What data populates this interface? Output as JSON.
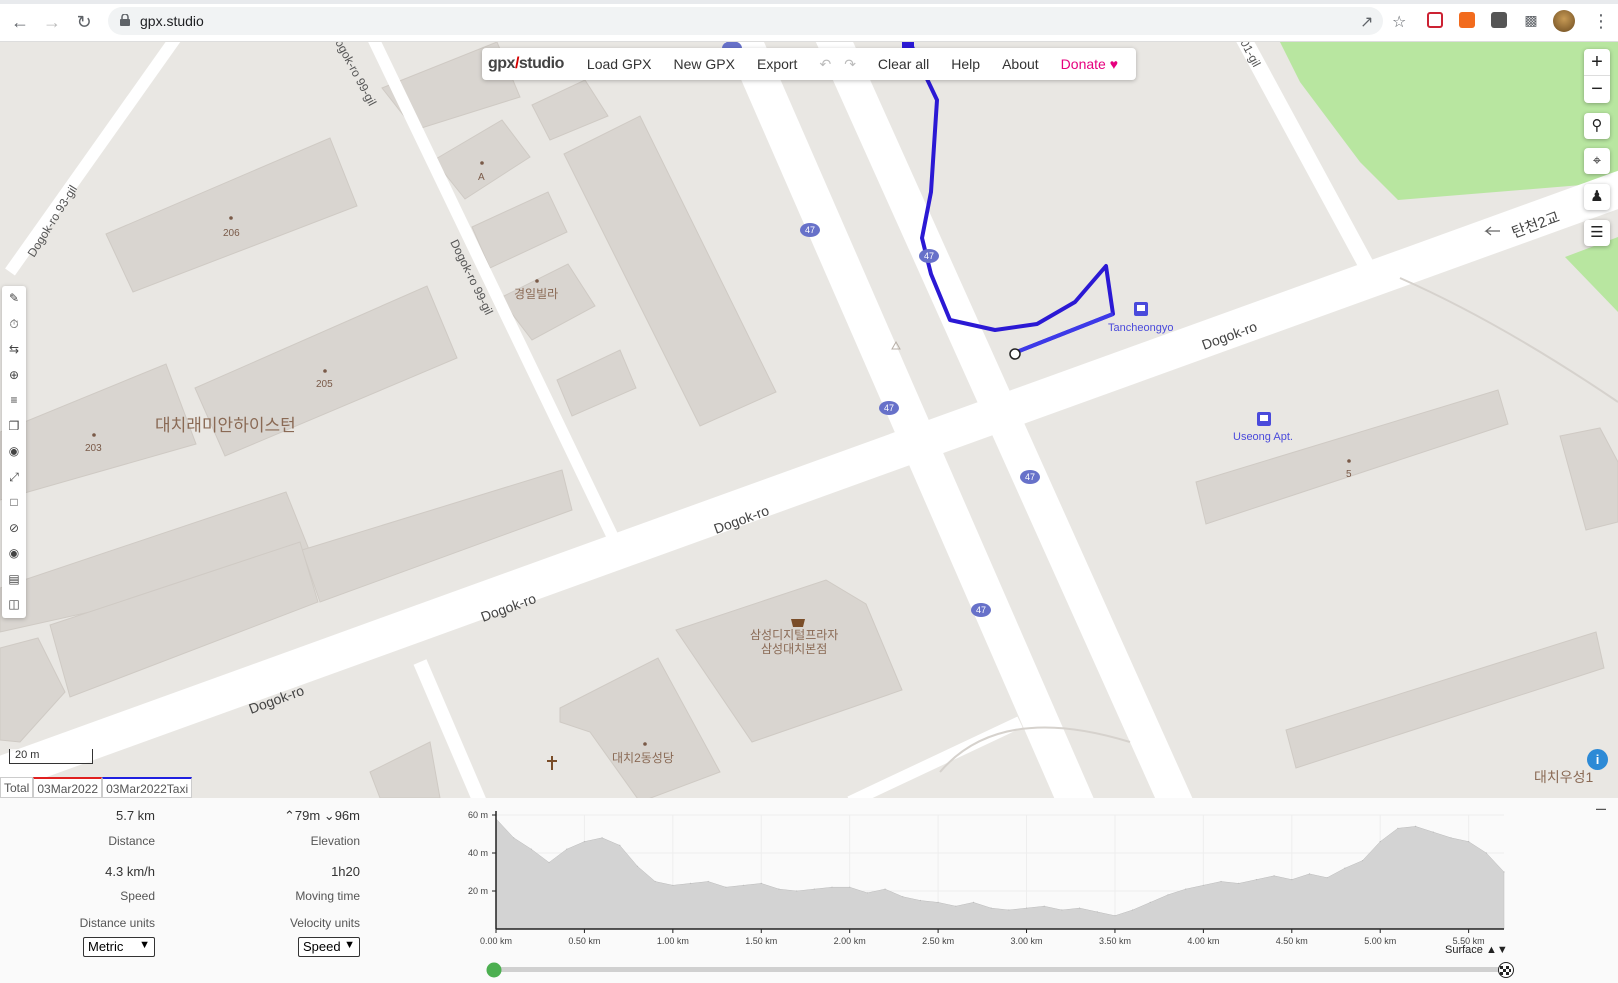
{
  "browser": {
    "url": "gpx.studio"
  },
  "toolbar": {
    "logo": "gpx.studio",
    "logo_a": "gpx",
    "logo_b": "studio",
    "load": "Load GPX",
    "new": "New GPX",
    "export": "Export",
    "clear": "Clear all",
    "help": "Help",
    "about": "About",
    "donate": "Donate"
  },
  "map": {
    "scale_label": "20 m",
    "labels": {
      "dogok_ro_93": "Dogok-ro 93-gil",
      "dogok_ro_99_top": "ogok-ro 99-gil",
      "dogok_ro_99": "Dogok-ro 99-gil",
      "gil_top": "01-gil",
      "dogok_ro_1": "Dogok-ro",
      "dogok_ro_2": "Dogok-ro",
      "dogok_ro_3": "Dogok-ro",
      "dogok_ro_4": "Dogok-ro",
      "tancheon_bridge": "탄천2교",
      "daechi_raemian": "대치래미안하이스턴",
      "gyeongil_villa": "경일빌라",
      "samsung_digital": "삼성디지털프라자",
      "samsung_daechi": "삼성대치본점",
      "daechi2_church": "대치2동성당",
      "daechi_bottom": "대치우성1",
      "building_206": "206",
      "building_205": "205",
      "building_203": "203",
      "building_a": "A",
      "building_5": "5",
      "stop_tancheongyo": "Tancheongyo",
      "stop_useong": "Useong Apt.",
      "route_47": "47"
    }
  },
  "track_tabs": [
    "Total",
    "03Mar2022",
    "03Mar2022Taxi"
  ],
  "stats": {
    "distance_value": "5.7 km",
    "distance_label": "Distance",
    "elevation_up": "79m",
    "elevation_down": "96m",
    "elevation_label": "Elevation",
    "speed_value": "4.3 km/h",
    "speed_label": "Speed",
    "moving_time_value": "1h20",
    "moving_time_label": "Moving time",
    "distance_units_label": "Distance units",
    "distance_units_value": "Metric",
    "velocity_units_label": "Velocity units",
    "velocity_units_value": "Speed"
  },
  "chart_data": {
    "type": "area",
    "title": "",
    "xlabel": "",
    "ylabel": "",
    "ylim": [
      0,
      60
    ],
    "xlim": [
      0,
      5.7
    ],
    "x_ticks": [
      "0.00 km",
      "0.50 km",
      "1.00 km",
      "1.50 km",
      "2.00 km",
      "2.50 km",
      "3.00 km",
      "3.50 km",
      "4.00 km",
      "4.50 km",
      "5.00 km",
      "5.50 km"
    ],
    "y_ticks": [
      "20 m",
      "40 m",
      "60 m"
    ],
    "x": [
      0.0,
      0.1,
      0.2,
      0.3,
      0.4,
      0.5,
      0.6,
      0.7,
      0.8,
      0.9,
      1.0,
      1.1,
      1.2,
      1.3,
      1.4,
      1.5,
      1.6,
      1.7,
      1.8,
      1.9,
      2.0,
      2.1,
      2.2,
      2.3,
      2.4,
      2.5,
      2.6,
      2.7,
      2.8,
      2.9,
      3.0,
      3.1,
      3.2,
      3.3,
      3.4,
      3.5,
      3.6,
      3.7,
      3.8,
      3.9,
      4.0,
      4.1,
      4.2,
      4.3,
      4.4,
      4.5,
      4.6,
      4.7,
      4.8,
      4.9,
      5.0,
      5.1,
      5.2,
      5.3,
      5.4,
      5.5,
      5.6,
      5.7
    ],
    "series": [
      {
        "values": [
          58,
          48,
          42,
          35,
          42,
          46,
          48,
          44,
          33,
          25,
          23,
          24,
          25,
          22,
          23,
          24,
          21,
          20,
          21,
          22,
          22,
          19,
          21,
          17,
          15,
          14,
          12,
          14,
          11,
          10,
          11,
          12,
          10,
          11,
          9,
          7,
          10,
          14,
          18,
          21,
          23,
          25,
          24,
          26,
          28,
          26,
          29,
          27,
          32,
          36,
          46,
          53,
          54,
          51,
          48,
          46,
          40,
          30
        ]
      }
    ],
    "grid": true,
    "legend": "",
    "footer_label": "Surface"
  },
  "colors": {
    "track": "#2b19d4",
    "accent_pink": "#e6007e",
    "park": "#b8e6a0",
    "building": "#d9d5d0",
    "road": "#ffffff",
    "label_brown": "#8a6a55",
    "route_badge": "#6771c9"
  }
}
